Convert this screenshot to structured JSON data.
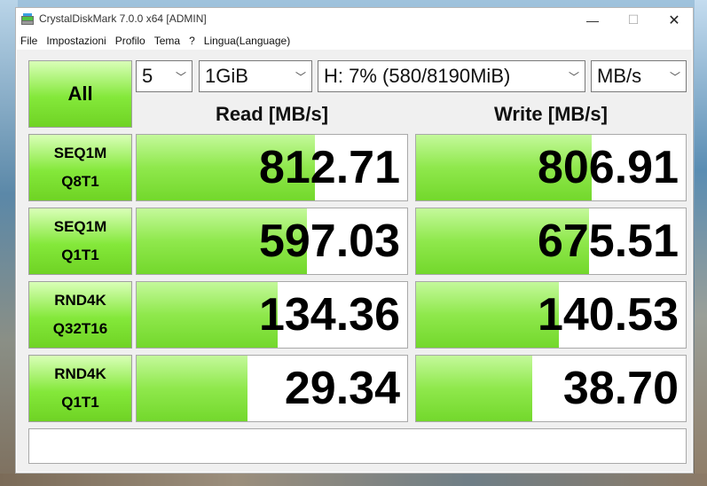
{
  "window": {
    "title": "CrystalDiskMark 7.0.0 x64 [ADMIN]",
    "minimize_glyph": "—",
    "maximize_glyph": "☐",
    "close_glyph": "✕"
  },
  "menu": [
    "File",
    "Impostazioni",
    "Profilo",
    "Tema",
    "?",
    "Lingua(Language)"
  ],
  "toolbar": {
    "all_label": "All",
    "count": "5",
    "size": "1GiB",
    "drive": "H: 7% (580/8190MiB)",
    "unit": "MB/s"
  },
  "headers": {
    "read": "Read [MB/s]",
    "write": "Write [MB/s]"
  },
  "tests": [
    {
      "line1": "SEQ1M",
      "line2": "Q8T1",
      "read": "812.71",
      "write": "806.91",
      "read_level": 0.66,
      "write_level": 0.65
    },
    {
      "line1": "SEQ1M",
      "line2": "Q1T1",
      "read": "597.03",
      "write": "675.51",
      "read_level": 0.63,
      "write_level": 0.64
    },
    {
      "line1": "RND4K",
      "line2": "Q32T16",
      "read": "134.36",
      "write": "140.53",
      "read_level": 0.52,
      "write_level": 0.53
    },
    {
      "line1": "RND4K",
      "line2": "Q1T1",
      "read": "29.34",
      "write": "38.70",
      "read_level": 0.41,
      "write_level": 0.43
    }
  ],
  "comment": "",
  "colors": {
    "meter_fill": "#8fe84c",
    "button_green": "#84e83a"
  }
}
